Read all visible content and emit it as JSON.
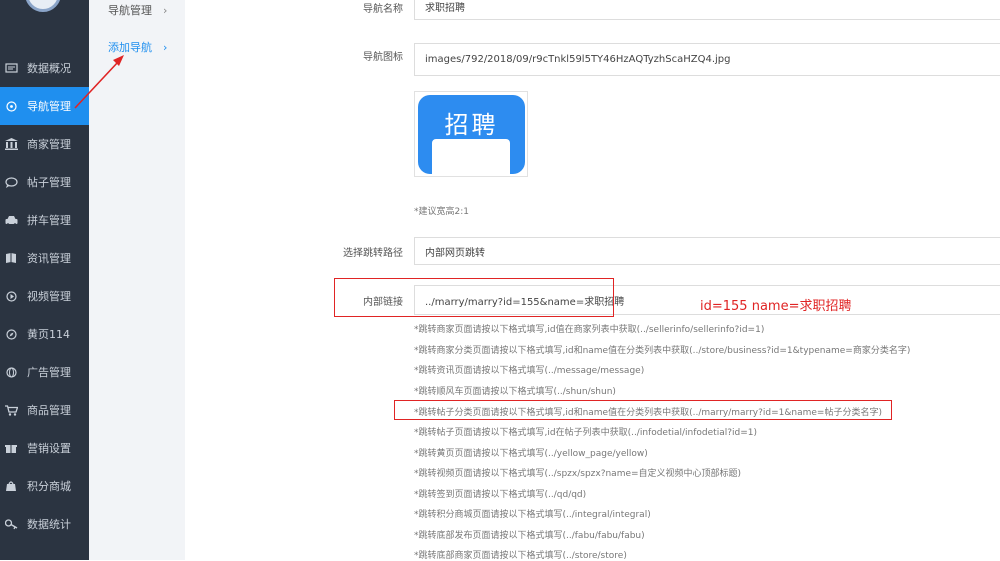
{
  "sidebar": {
    "items": [
      {
        "label": "数据概况",
        "icon": "monitor-icon"
      },
      {
        "label": "导航管理",
        "icon": "compass-icon"
      },
      {
        "label": "商家管理",
        "icon": "bank-icon"
      },
      {
        "label": "帖子管理",
        "icon": "chat-icon"
      },
      {
        "label": "拼车管理",
        "icon": "car-icon"
      },
      {
        "label": "资讯管理",
        "icon": "book-icon"
      },
      {
        "label": "视频管理",
        "icon": "play-icon"
      },
      {
        "label": "黄页114",
        "icon": "compass2-icon"
      },
      {
        "label": "广告管理",
        "icon": "globe-icon"
      },
      {
        "label": "商品管理",
        "icon": "cart-icon"
      },
      {
        "label": "营销设置",
        "icon": "gift-icon"
      },
      {
        "label": "积分商城",
        "icon": "shop-icon"
      },
      {
        "label": "数据统计",
        "icon": "key-icon"
      }
    ],
    "active_index": 1,
    "active_color": "#1f8fef"
  },
  "submenu": {
    "items": [
      {
        "label": "导航管理",
        "chevron": "›"
      },
      {
        "label": "添加导航",
        "chevron": "›"
      }
    ]
  },
  "form": {
    "name": {
      "label": "导航名称",
      "value": "求职招聘"
    },
    "icon": {
      "label": "导航图标",
      "value": "images/792/2018/09/r9cTnkl59l5TY46HzAQTyzhScaHZQ4.jpg"
    },
    "preview_text": "招聘",
    "size_hint": "*建议宽高2:1",
    "route": {
      "label": "选择跳转路径",
      "value": "内部网页跳转"
    },
    "link": {
      "label": "内部链接",
      "value": "../marry/marry?id=155&name=求职招聘"
    },
    "annotation": "id=155  name=求职招聘",
    "hints": [
      "*跳转商家页面请按以下格式填写,id值在商家列表中获取(../sellerinfo/sellerinfo?id=1)",
      "*跳转商家分类页面请按以下格式填写,id和name值在分类列表中获取(../store/business?id=1&typename=商家分类名字)",
      "*跳转资讯页面请按以下格式填写(../message/message)",
      "*跳转顺风车页面请按以下格式填写(../shun/shun)",
      "*跳转帖子分类页面请按以下格式填写,id和name值在分类列表中获取(../marry/marry?id=1&name=帖子分类名字)",
      "*跳转帖子页面请按以下格式填写,id在帖子列表中获取(../infodetial/infodetial?id=1)",
      "*跳转黄页页面请按以下格式填写(../yellow_page/yellow)",
      "*跳转视频页面请按以下格式填写(../spzx/spzx?name=自定义视频中心顶部标题)",
      "*跳转签到页面请按以下格式填写(../qd/qd)",
      "*跳转积分商城页面请按以下格式填写(../integral/integral)",
      "*跳转底部发布页面请按以下格式填写(../fabu/fabu/fabu)",
      "*跳转底部商家页面请按以下格式填写(../store/store)"
    ]
  },
  "colors": {
    "annotation_red": "#e02424",
    "sidebar_bg": "#2b3441",
    "accent": "#1f8fef"
  }
}
